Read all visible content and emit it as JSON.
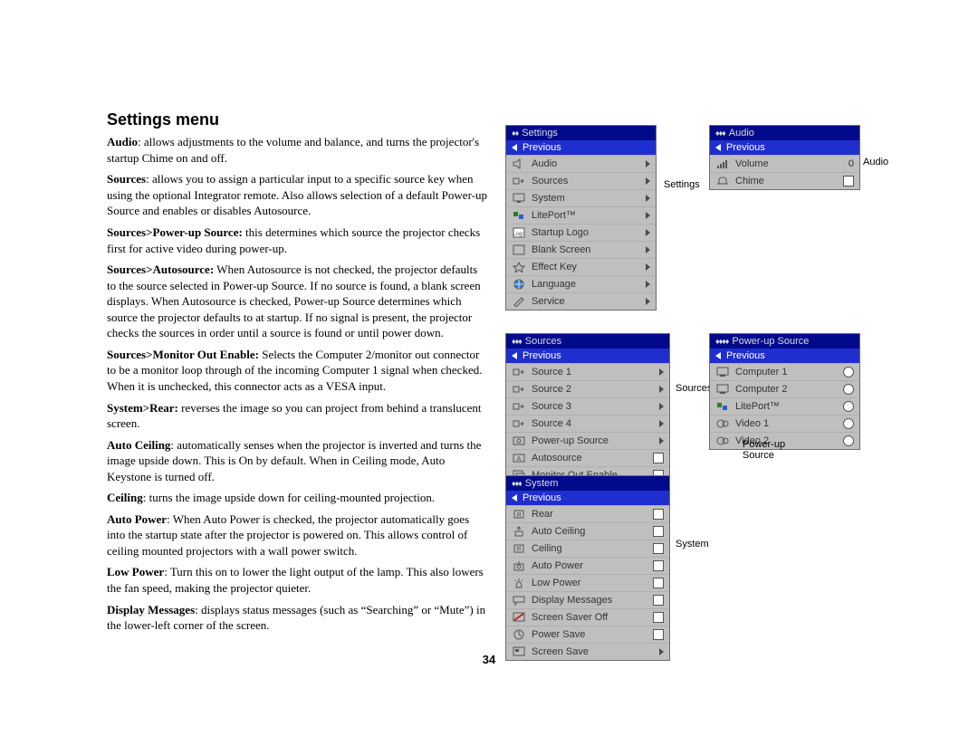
{
  "heading": "Settings menu",
  "page_number": "34",
  "paragraphs": [
    {
      "bold": "Audio",
      "text": ": allows adjustments to the volume and balance, and turns the projector's startup Chime on and off."
    },
    {
      "bold": "Sources",
      "text": ": allows you to assign a particular input to a specific source key when using the optional Integrator remote. Also allows selection of a default Power-up Source and enables or disables Autosource."
    },
    {
      "bold": "Sources>Power-up Source:",
      "text": " this determines which source the projector checks first for active video during power-up."
    },
    {
      "bold": "Sources>Autosource:",
      "text": " When Autosource is not checked, the projector defaults to the source selected in Power-up Source. If no source is found, a blank screen displays. When Autosource is checked, Power-up Source determines which source the projector defaults to at startup. If no signal is present, the projector checks the sources in order until a source is found or until power down."
    },
    {
      "bold": "Sources>Monitor Out Enable:",
      "text": " Selects the Computer 2/monitor out connector to be a monitor loop through of the incoming Computer 1 signal when checked. When it is unchecked, this connector acts as a VESA input."
    },
    {
      "bold": "System>Rear:",
      "text": " reverses the image so you can project from behind a translucent screen."
    },
    {
      "bold": "Auto Ceiling",
      "text": ": automatically senses when the projector is inverted and turns the image upside down. This is On by default. When in Ceiling mode, Auto Keystone is turned off."
    },
    {
      "bold": "Ceiling",
      "text": ": turns the image upside down for ceiling-mounted projection."
    },
    {
      "bold": "Auto Power",
      "text": ": When Auto Power is checked, the projector automatically goes into the startup state after the projector is powered on. This allows control of ceiling mounted projectors with a wall power switch."
    },
    {
      "bold": "Low Power",
      "text": ": Turn this on to lower the light output of the lamp. This also lowers the fan speed, making the projector quieter."
    },
    {
      "bold": "Display Messages",
      "text": ": displays status messages (such as “Searching” or “Mute”) in the lower-left corner of the screen."
    }
  ],
  "menus": {
    "settings": {
      "title": "Settings",
      "diamonds": "♦♦",
      "previous": "Previous",
      "items": [
        {
          "label": "Audio",
          "icon": "speaker",
          "ind": "arrow"
        },
        {
          "label": "Sources",
          "icon": "sources",
          "ind": "arrow"
        },
        {
          "label": "System",
          "icon": "system",
          "ind": "arrow"
        },
        {
          "label": "LitePort™",
          "icon": "liteport",
          "ind": "arrow"
        },
        {
          "label": "Startup Logo",
          "icon": "logo",
          "ind": "arrow"
        },
        {
          "label": "Blank Screen",
          "icon": "blank",
          "ind": "arrow"
        },
        {
          "label": "Effect Key",
          "icon": "star",
          "ind": "arrow"
        },
        {
          "label": "Language",
          "icon": "globe",
          "ind": "arrow"
        },
        {
          "label": "Service",
          "icon": "pencil",
          "ind": "arrow"
        }
      ],
      "caption": "Settings"
    },
    "audio": {
      "title": "Audio",
      "diamonds": "♦♦♦",
      "previous": "Previous",
      "items": [
        {
          "label": "Volume",
          "icon": "volume",
          "ind": "value",
          "value": "0"
        },
        {
          "label": "Chime",
          "icon": "chime",
          "ind": "check"
        }
      ],
      "caption": "Audio"
    },
    "sources": {
      "title": "Sources",
      "diamonds": "♦♦♦",
      "previous": "Previous",
      "items": [
        {
          "label": "Source 1",
          "icon": "src",
          "ind": "arrow"
        },
        {
          "label": "Source 2",
          "icon": "src",
          "ind": "arrow"
        },
        {
          "label": "Source 3",
          "icon": "src",
          "ind": "arrow"
        },
        {
          "label": "Source 4",
          "icon": "src",
          "ind": "arrow"
        },
        {
          "label": "Power-up Source",
          "icon": "power",
          "ind": "arrow"
        },
        {
          "label": "Autosource",
          "icon": "auto",
          "ind": "check"
        },
        {
          "label": "Monitor Out Enable",
          "icon": "monitor",
          "ind": "check"
        }
      ],
      "caption": "Sources"
    },
    "powerup": {
      "title": "Power-up Source",
      "diamonds": "♦♦♦♦",
      "previous": "Previous",
      "items": [
        {
          "label": "Computer 1",
          "icon": "comp",
          "ind": "radio"
        },
        {
          "label": "Computer 2",
          "icon": "comp",
          "ind": "radio"
        },
        {
          "label": "LitePort™",
          "icon": "liteport",
          "ind": "radio"
        },
        {
          "label": "Video 1",
          "icon": "video",
          "ind": "radio"
        },
        {
          "label": "Video 2",
          "icon": "video",
          "ind": "radio"
        }
      ],
      "caption": "Power-up\nSource"
    },
    "system": {
      "title": "System",
      "diamonds": "♦♦♦",
      "previous": "Previous",
      "items": [
        {
          "label": "Rear",
          "icon": "rear",
          "ind": "check"
        },
        {
          "label": "Auto Ceiling",
          "icon": "autoceil",
          "ind": "check"
        },
        {
          "label": "Ceiling",
          "icon": "ceiling",
          "ind": "check"
        },
        {
          "label": "Auto Power",
          "icon": "autopow",
          "ind": "check"
        },
        {
          "label": "Low Power",
          "icon": "lowpow",
          "ind": "check"
        },
        {
          "label": "Display Messages",
          "icon": "chat",
          "ind": "check"
        },
        {
          "label": "Screen Saver Off",
          "icon": "ssoff",
          "ind": "check"
        },
        {
          "label": "Power Save",
          "icon": "psave",
          "ind": "check"
        },
        {
          "label": "Screen Save",
          "icon": "ssave",
          "ind": "arrow"
        }
      ],
      "caption": "System"
    }
  }
}
